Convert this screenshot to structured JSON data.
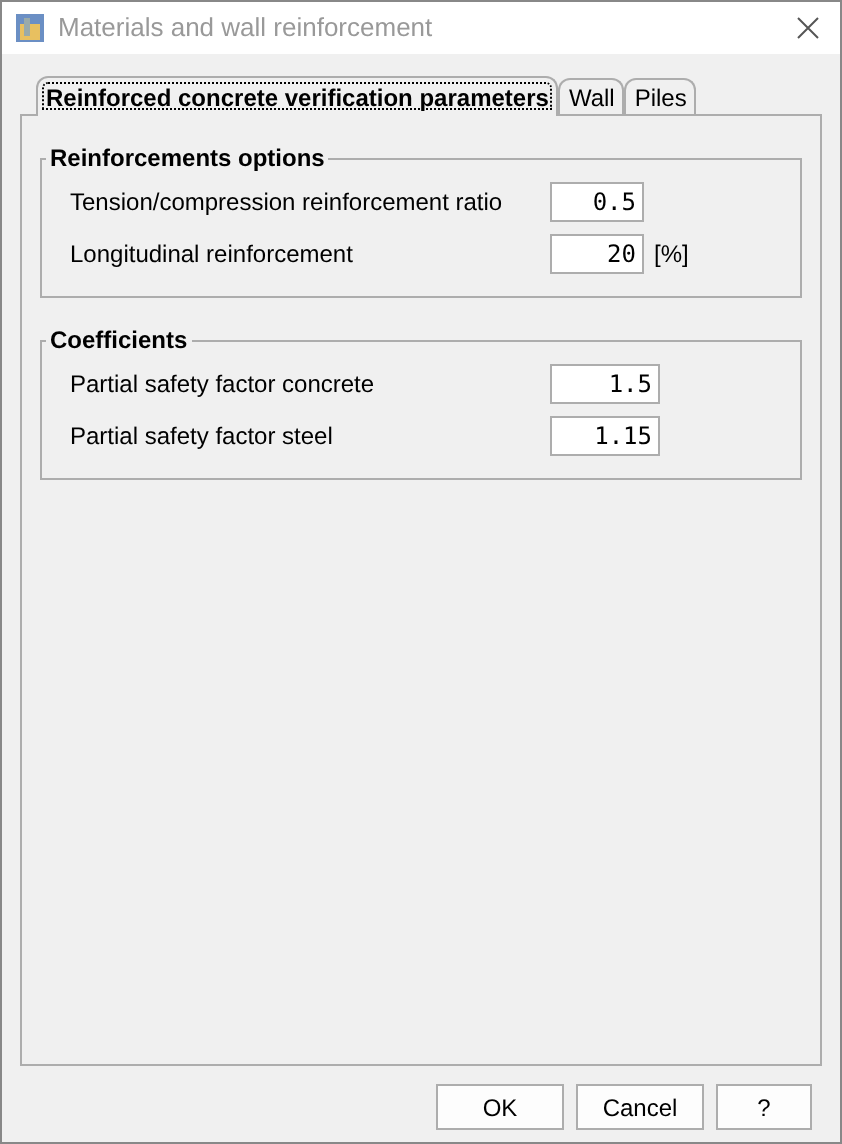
{
  "window": {
    "title": "Materials and wall reinforcement"
  },
  "tabs": [
    {
      "label": "Reinforced concrete verification parameters",
      "selected": true
    },
    {
      "label": "Wall",
      "selected": false
    },
    {
      "label": "Piles",
      "selected": false
    }
  ],
  "groups": [
    {
      "title": "Reinforcements options",
      "fields": [
        {
          "label": "Tension/compression reinforcement ratio",
          "value": "0.5"
        },
        {
          "label": "Longitudinal reinforcement",
          "value": "20",
          "unit": "[%]"
        }
      ]
    },
    {
      "title": "Coefficients",
      "fields": [
        {
          "label": "Partial safety factor concrete",
          "value": "1.5"
        },
        {
          "label": "Partial safety factor steel",
          "value": "1.15"
        }
      ]
    }
  ],
  "buttons": [
    "OK",
    "Cancel",
    "?"
  ]
}
